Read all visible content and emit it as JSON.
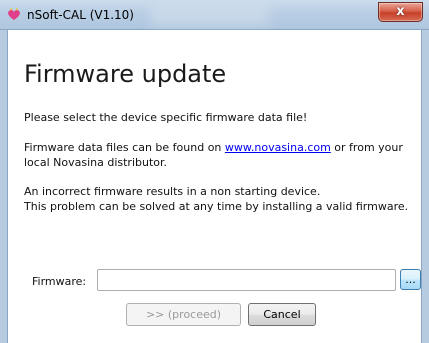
{
  "window": {
    "title": "nSoft-CAL (V1.10)",
    "close_symbol": "x"
  },
  "icons": {
    "app": "nsoft-heart-icon",
    "close": "close-icon"
  },
  "main": {
    "heading": "Firmware update",
    "para1": "Please select the device specific firmware data file!",
    "para2_before": "Firmware data files can be found on ",
    "para2_link": "www.novasina.com",
    "para2_after": " or from your local Novasina distributor.",
    "para3_line1": "An incorrect firmware results in a non starting device.",
    "para3_line2": "This problem can be solved at any time by installing a valid firmware."
  },
  "firmware": {
    "label": "Firmware:",
    "value": "",
    "browse_label": "..."
  },
  "buttons": {
    "proceed_label": ">> (proceed)",
    "cancel_label": "Cancel"
  },
  "colors": {
    "link": "#0000ee",
    "close_button": "#c7402a",
    "app_icon": "#e0408a"
  }
}
